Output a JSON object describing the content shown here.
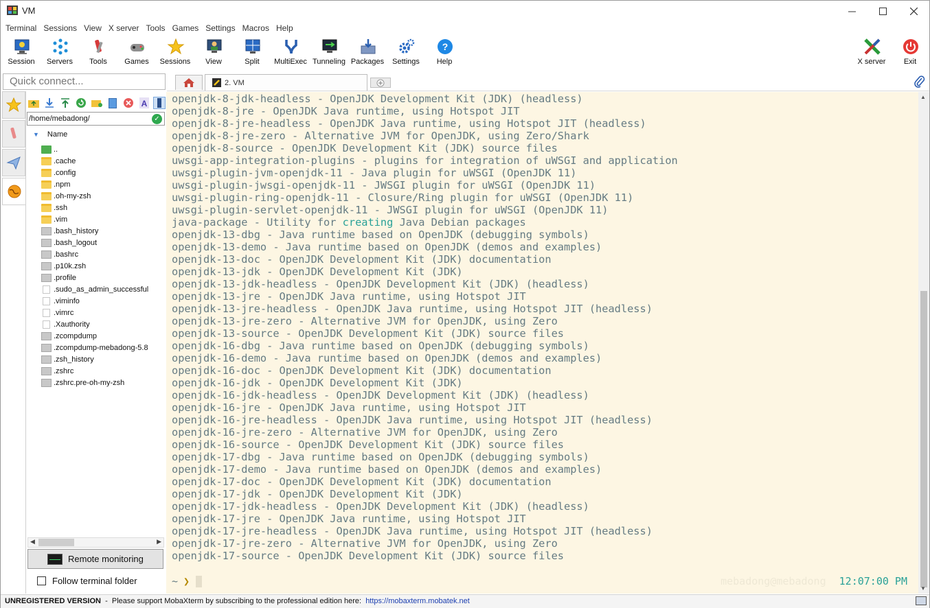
{
  "window": {
    "title": "VM",
    "controls": [
      "minimize",
      "maximize",
      "close"
    ]
  },
  "menu": [
    "Terminal",
    "Sessions",
    "View",
    "X server",
    "Tools",
    "Games",
    "Settings",
    "Macros",
    "Help"
  ],
  "toolbar": {
    "items": [
      {
        "label": "Session",
        "icon": "session-icon"
      },
      {
        "label": "Servers",
        "icon": "servers-icon"
      },
      {
        "label": "Tools",
        "icon": "tools-icon"
      },
      {
        "label": "Games",
        "icon": "games-icon"
      },
      {
        "label": "Sessions",
        "icon": "star-icon"
      },
      {
        "label": "View",
        "icon": "view-icon"
      },
      {
        "label": "Split",
        "icon": "split-icon"
      },
      {
        "label": "MultiExec",
        "icon": "multiexec-icon"
      },
      {
        "label": "Tunneling",
        "icon": "tunneling-icon"
      },
      {
        "label": "Packages",
        "icon": "packages-icon"
      },
      {
        "label": "Settings",
        "icon": "gear-icon"
      },
      {
        "label": "Help",
        "icon": "help-icon"
      }
    ],
    "right_items": [
      {
        "label": "X server",
        "icon": "x-server-icon"
      },
      {
        "label": "Exit",
        "icon": "power-icon"
      }
    ]
  },
  "quick_connect": {
    "placeholder": "Quick connect..."
  },
  "tabs": {
    "home_icon": "home-icon",
    "session_tab": "2. VM"
  },
  "sftp": {
    "path": "/home/mebadong/",
    "column_header": "Name",
    "files": [
      {
        "name": "..",
        "type": "up"
      },
      {
        "name": ".cache",
        "type": "folder"
      },
      {
        "name": ".config",
        "type": "folder"
      },
      {
        "name": ".npm",
        "type": "folder"
      },
      {
        "name": ".oh-my-zsh",
        "type": "folder"
      },
      {
        "name": ".ssh",
        "type": "folder"
      },
      {
        "name": ".vim",
        "type": "folder"
      },
      {
        "name": ".bash_history",
        "type": "file"
      },
      {
        "name": ".bash_logout",
        "type": "file"
      },
      {
        "name": ".bashrc",
        "type": "file"
      },
      {
        "name": ".p10k.zsh",
        "type": "file"
      },
      {
        "name": ".profile",
        "type": "file"
      },
      {
        "name": ".sudo_as_admin_successful",
        "type": "blank"
      },
      {
        "name": ".viminfo",
        "type": "blank"
      },
      {
        "name": ".vimrc",
        "type": "blank"
      },
      {
        "name": ".Xauthority",
        "type": "blank"
      },
      {
        "name": ".zcompdump",
        "type": "file"
      },
      {
        "name": ".zcompdump-mebadong-5.8",
        "type": "file"
      },
      {
        "name": ".zsh_history",
        "type": "file"
      },
      {
        "name": ".zshrc",
        "type": "file"
      },
      {
        "name": ".zshrc.pre-oh-my-zsh",
        "type": "file"
      }
    ],
    "remote_monitoring": "Remote monitoring",
    "follow_terminal_folder": "Follow terminal folder"
  },
  "terminal": {
    "lines": [
      "openjdk-8-jdk-headless - OpenJDK Development Kit (JDK) (headless)",
      "openjdk-8-jre - OpenJDK Java runtime, using Hotspot JIT",
      "openjdk-8-jre-headless - OpenJDK Java runtime, using Hotspot JIT (headless)",
      "openjdk-8-jre-zero - Alternative JVM for OpenJDK, using Zero/Shark",
      "openjdk-8-source - OpenJDK Development Kit (JDK) source files",
      "uwsgi-app-integration-plugins - plugins for integration of uWSGI and application",
      "uwsgi-plugin-jvm-openjdk-11 - Java plugin for uWSGI (OpenJDK 11)",
      "uwsgi-plugin-jwsgi-openjdk-11 - JWSGI plugin for uWSGI (OpenJDK 11)",
      "uwsgi-plugin-ring-openjdk-11 - Closure/Ring plugin for uWSGI (OpenJDK 11)",
      "uwsgi-plugin-servlet-openjdk-11 - JWSGI plugin for uWSGI (OpenJDK 11)",
      "java-package - Utility for creating Java Debian packages",
      "openjdk-13-dbg - Java runtime based on OpenJDK (debugging symbols)",
      "openjdk-13-demo - Java runtime based on OpenJDK (demos and examples)",
      "openjdk-13-doc - OpenJDK Development Kit (JDK) documentation",
      "openjdk-13-jdk - OpenJDK Development Kit (JDK)",
      "openjdk-13-jdk-headless - OpenJDK Development Kit (JDK) (headless)",
      "openjdk-13-jre - OpenJDK Java runtime, using Hotspot JIT",
      "openjdk-13-jre-headless - OpenJDK Java runtime, using Hotspot JIT (headless)",
      "openjdk-13-jre-zero - Alternative JVM for OpenJDK, using Zero",
      "openjdk-13-source - OpenJDK Development Kit (JDK) source files",
      "openjdk-16-dbg - Java runtime based on OpenJDK (debugging symbols)",
      "openjdk-16-demo - Java runtime based on OpenJDK (demos and examples)",
      "openjdk-16-doc - OpenJDK Development Kit (JDK) documentation",
      "openjdk-16-jdk - OpenJDK Development Kit (JDK)",
      "openjdk-16-jdk-headless - OpenJDK Development Kit (JDK) (headless)",
      "openjdk-16-jre - OpenJDK Java runtime, using Hotspot JIT",
      "openjdk-16-jre-headless - OpenJDK Java runtime, using Hotspot JIT (headless)",
      "openjdk-16-jre-zero - Alternative JVM for OpenJDK, using Zero",
      "openjdk-16-source - OpenJDK Development Kit (JDK) source files",
      "openjdk-17-dbg - Java runtime based on OpenJDK (debugging symbols)",
      "openjdk-17-demo - Java runtime based on OpenJDK (demos and examples)",
      "openjdk-17-doc - OpenJDK Development Kit (JDK) documentation",
      "openjdk-17-jdk - OpenJDK Development Kit (JDK)",
      "openjdk-17-jdk-headless - OpenJDK Development Kit (JDK) (headless)",
      "openjdk-17-jre - OpenJDK Java runtime, using Hotspot JIT",
      "openjdk-17-jre-headless - OpenJDK Java runtime, using Hotspot JIT (headless)",
      "openjdk-17-jre-zero - Alternative JVM for OpenJDK, using Zero",
      "openjdk-17-source - OpenJDK Development Kit (JDK) source files"
    ],
    "highlight_word": "creating",
    "prompt_dir": "~",
    "prompt_symbol": "❯",
    "right_prompt_user": "mebadong@mebadong",
    "right_prompt_time": "12:07:00 PM",
    "colors": {
      "background": "#fdf6e3",
      "text": "#657b83",
      "accent": "#2aa198",
      "prompt": "#b58900"
    }
  },
  "status": {
    "label": "UNREGISTERED VERSION",
    "message": "  -  Please support MobaXterm by subscribing to the professional edition here:  ",
    "link": "https://mobaxterm.mobatek.net"
  }
}
